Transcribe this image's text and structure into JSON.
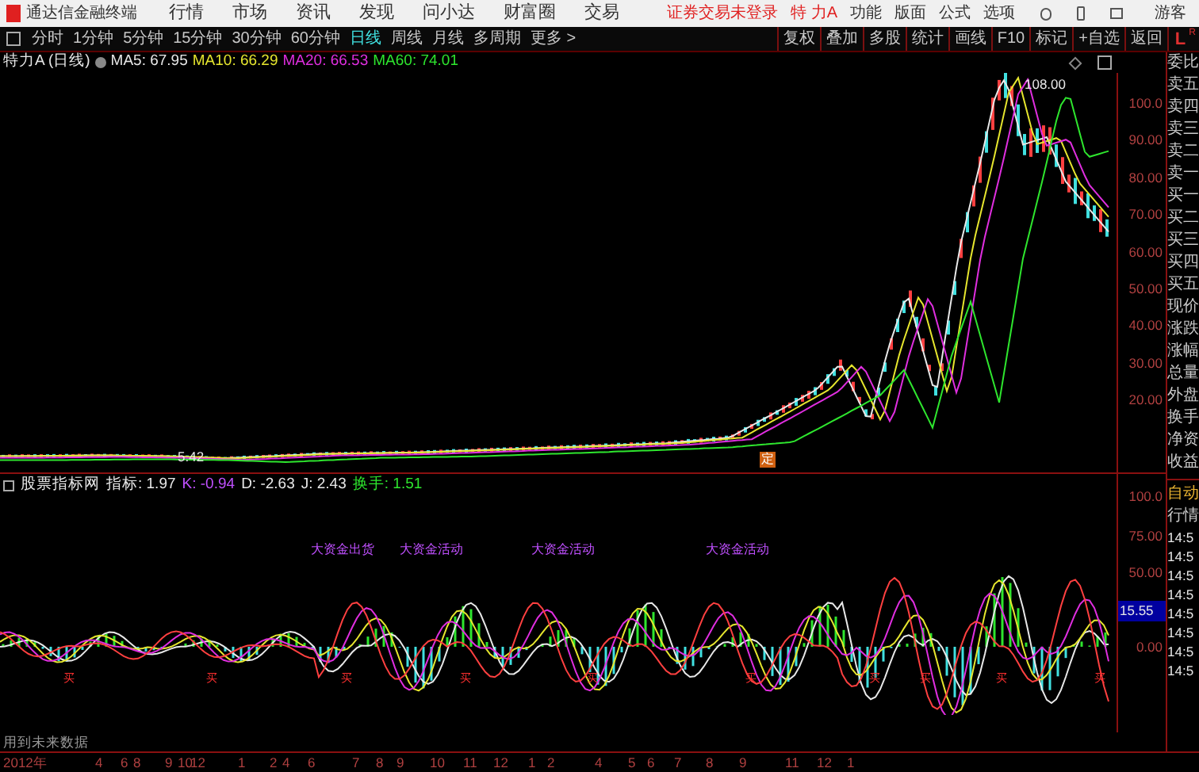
{
  "menu_bar": {
    "app_name": "通达信金融终端",
    "items": [
      "行情",
      "市场",
      "资讯",
      "发现",
      "问小达",
      "财富圈",
      "交易"
    ],
    "login_notice": "证券交易未登录",
    "stock_name": "特 力A",
    "right_items": [
      "功能",
      "版面",
      "公式",
      "选项"
    ],
    "user": "游客"
  },
  "period_tabs": [
    {
      "label": "分时",
      "selected": false
    },
    {
      "label": "1分钟",
      "selected": false
    },
    {
      "label": "5分钟",
      "selected": false
    },
    {
      "label": "15分钟",
      "selected": false
    },
    {
      "label": "30分钟",
      "selected": false
    },
    {
      "label": "60分钟",
      "selected": false
    },
    {
      "label": "日线",
      "selected": true
    },
    {
      "label": "周线",
      "selected": false
    },
    {
      "label": "月线",
      "selected": false
    },
    {
      "label": "多周期",
      "selected": false
    },
    {
      "label": "更多 >",
      "selected": false
    }
  ],
  "tool_buttons": [
    "复权",
    "叠加",
    "多股",
    "统计",
    "画线",
    "F10",
    "标记",
    "+自选",
    "返回"
  ],
  "panel_mode": {
    "left": "L",
    "right": "R"
  },
  "chart_header": {
    "title": "特力A (日线)",
    "mas": [
      {
        "label": "MA5: 67.95",
        "color": "#e8e8e8"
      },
      {
        "label": "MA10: 66.29",
        "color": "#e6e62e"
      },
      {
        "label": "MA20: 66.53",
        "color": "#e02ee0"
      },
      {
        "label": "MA60: 74.01",
        "color": "#2ee62e"
      }
    ]
  },
  "price_axis": [
    "100.0",
    "90.00",
    "80.00",
    "70.00",
    "60.00",
    "50.00",
    "40.00",
    "30.00",
    "20.00"
  ],
  "price_labels": {
    "high": "108.00",
    "low": "5.42"
  },
  "event_marker": "定",
  "indicator_header": {
    "name": "股票指标网",
    "values": [
      {
        "label": "指标: 1.97",
        "color": "#e8e8e8"
      },
      {
        "label": "K: -0.94",
        "color": "#c050ff"
      },
      {
        "label": "D: -2.63",
        "color": "#e8e8e8"
      },
      {
        "label": "J: 2.43",
        "color": "#e8e8e8"
      },
      {
        "label": "换手: 1.51",
        "color": "#2ee62e"
      }
    ]
  },
  "indicator_axis": [
    "100.0",
    "75.00",
    "50.00",
    "0.00"
  ],
  "indicator_reading": "15.55",
  "indicator_labels": [
    "大资金出货",
    "大资金活动",
    "大资金活动",
    "大资金活动"
  ],
  "signal_marks": [
    "买",
    "买",
    "买",
    "买",
    "买",
    "买",
    "买",
    "买",
    "买",
    "买"
  ],
  "quote_panel": [
    "委比",
    "卖五",
    "卖四",
    "卖三",
    "卖二",
    "卖一",
    "买一",
    "买二",
    "买三",
    "买四",
    "买五",
    "现价",
    "涨跌",
    "涨幅",
    "总量",
    "外盘",
    "换手",
    "净资",
    "收益"
  ],
  "tick_panel": {
    "title": [
      "自动",
      "行情"
    ],
    "times": [
      "14:5",
      "14:5",
      "14:5",
      "14:5",
      "14:5",
      "14:5",
      "14:5",
      "14:5"
    ]
  },
  "footer_note": "用到未来数据",
  "date_axis": [
    "2012年",
    "4",
    "6",
    "8",
    "9",
    "10",
    "12",
    "1",
    "2",
    "4",
    "6",
    "7",
    "8",
    "9",
    "10",
    "11",
    "12",
    "1",
    "2",
    "4",
    "5",
    "6",
    "7",
    "8",
    "9",
    "11",
    "12",
    "1"
  ]
}
